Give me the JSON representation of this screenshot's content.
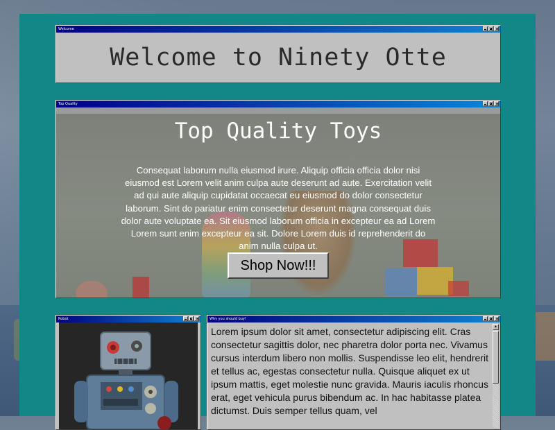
{
  "welcome_window": {
    "title": "Welcome",
    "heading": "Welcome to Ninety Otte"
  },
  "top_window": {
    "title": "Top Quality",
    "heading": "Top Quality Toys",
    "paragraph": "Consequat laborum nulla eiusmod irure. Aliquip officia officia dolor nisi eiusmod est Lorem velit anim culpa aute deserunt ad aute. Exercitation velit ad qui aute aliquip cupidatat occaecat eu eiusmod do dolor consectetur laborum. Sint do pariatur enim consectetur deserunt magna consequat duis dolor aute voluptate ea. Sit eiusmod laborum officia in excepteur ea ad Lorem Lorem sunt enim excepteur ea sit. Dolore Lorem duis id reprehenderit do anim nulla culpa ut.",
    "button_label": "Shop Now!!!"
  },
  "robot_window": {
    "title": "Robot"
  },
  "why_window": {
    "title": "Why you should buy!",
    "paragraph": "Lorem ipsum dolor sit amet, consectetur adipiscing elit. Cras consectetur sagittis dolor, nec pharetra dolor porta nec. Vivamus cursus interdum libero non mollis. Suspendisse leo elit, hendrerit et tellus ac, egestas consectetur nulla. Quisque aliquet ex ut ipsum mattis, eget molestie nunc gravida. Mauris iaculis rhoncus erat, eget vehicula purus bibendum ac. In hac habitasse platea dictumst. Duis semper tellus quam, vel"
  },
  "colors": {
    "page_bg": "#138787",
    "window_face": "#c0c0c0",
    "titlebar_start": "#000080",
    "titlebar_end": "#1084d0"
  }
}
